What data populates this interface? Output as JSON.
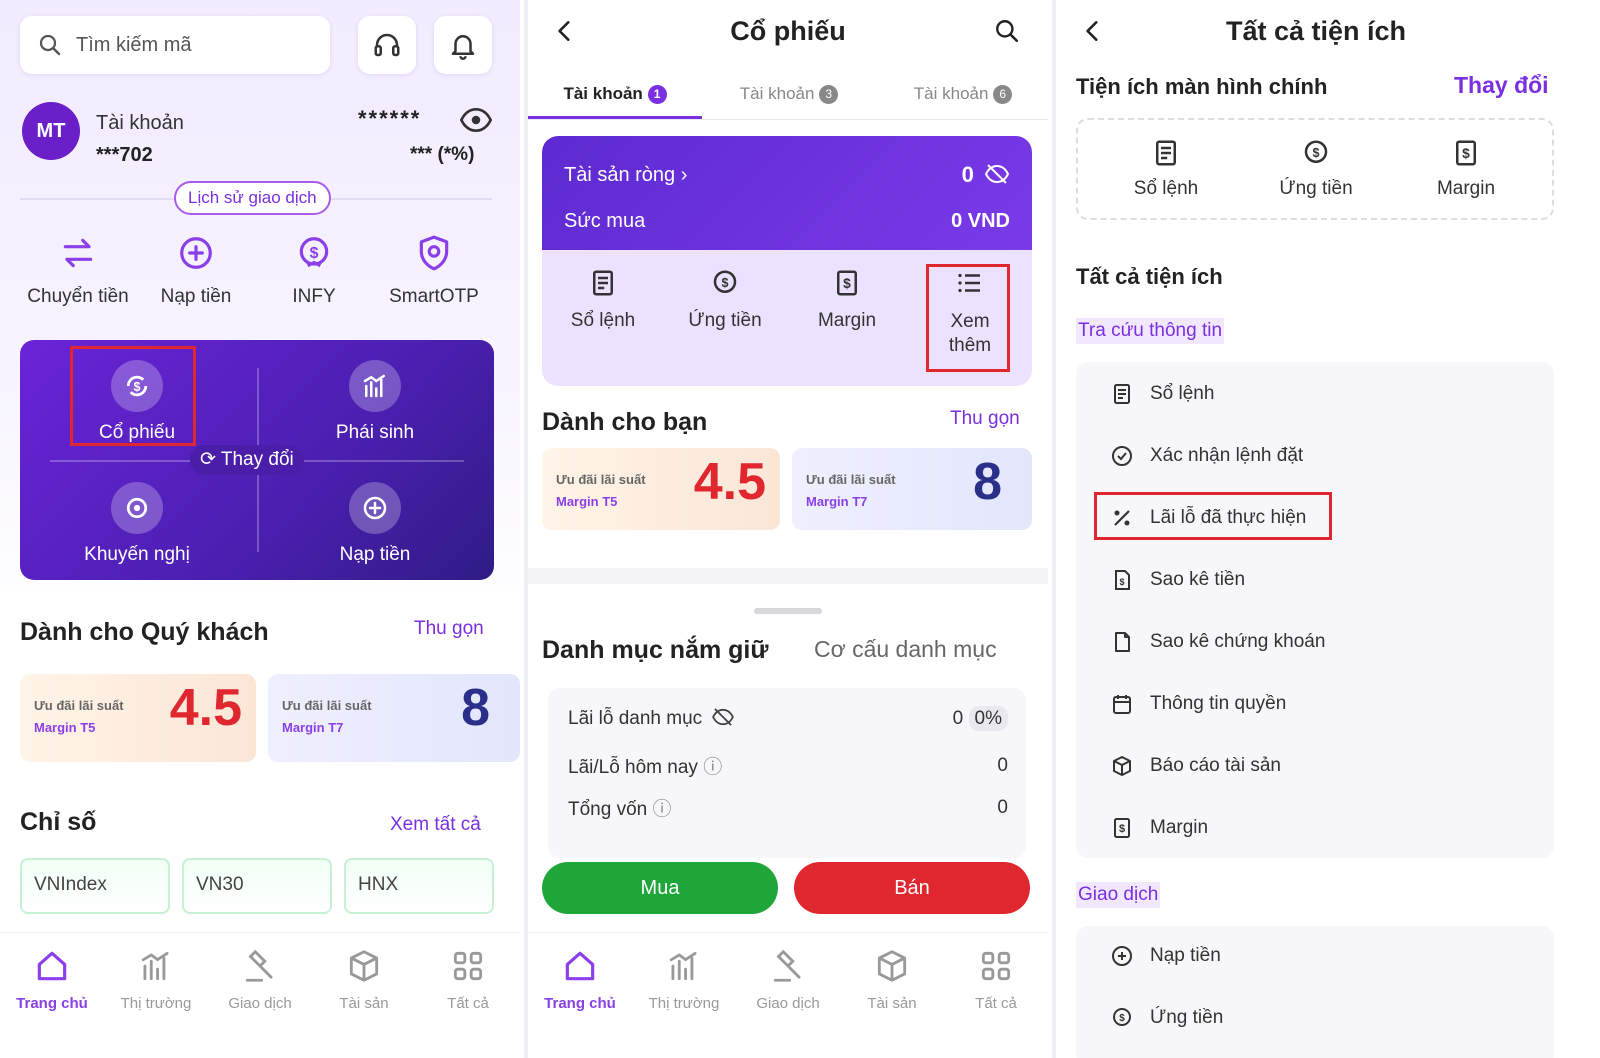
{
  "home": {
    "search_placeholder": "Tìm kiếm mã",
    "avatar_initials": "MT",
    "account_label": "Tài khoản",
    "account_number": "***702",
    "balance_masked": "******",
    "pnl_masked": "*** (*%)",
    "history_button": "Lịch sử giao dịch",
    "quick_actions": [
      "Chuyển tiền",
      "Nạp tiền",
      "INFY",
      "SmartOTP"
    ],
    "products": [
      "Cổ phiếu",
      "Phái sinh",
      "Khuyến nghị",
      "Nạp tiền"
    ],
    "change_label": "Thay đổi",
    "for_you_title": "Dành cho Quý khách",
    "collapse_link": "Thu gọn",
    "promos": [
      {
        "line1": "Ưu đãi lãi suất",
        "line2": "Margin T5",
        "big": "4.5",
        "big_color": "#e0262f"
      },
      {
        "line1": "Ưu đãi lãi suất",
        "line2": "Margin T7",
        "big": "8",
        "big_color": "#2a2f8a"
      }
    ],
    "index_title": "Chỉ số",
    "see_all_link": "Xem tất cả",
    "indices": [
      "VNIndex",
      "VN30",
      "HNX"
    ]
  },
  "tabbar": [
    "Trang chủ",
    "Thị trường",
    "Giao dịch",
    "Tài sản",
    "Tất cả"
  ],
  "stocks": {
    "title": "Cổ phiếu",
    "account_tabs": [
      {
        "label": "Tài khoản",
        "badge": "1"
      },
      {
        "label": "Tài khoản",
        "badge": "3"
      },
      {
        "label": "Tài khoản",
        "badge": "6"
      }
    ],
    "net_assets_label": "Tài sản ròng",
    "net_assets_value": "0",
    "buying_power_label": "Sức mua",
    "buying_power_value": "0 VND",
    "features": [
      "Sổ lệnh",
      "Ứng tiền",
      "Margin",
      "Xem thêm"
    ],
    "for_you_title": "Dành cho bạn",
    "collapse_link": "Thu gọn",
    "holdings_tab_active": "Danh mục nắm giữ",
    "holdings_tab_other": "Cơ cấu danh mục",
    "holdings_rows": [
      {
        "label": "Lãi lỗ danh mục",
        "value": "0",
        "extra": "0%"
      },
      {
        "label": "Lãi/Lỗ hôm nay",
        "value": "0"
      },
      {
        "label": "Tổng vốn",
        "value": "0"
      }
    ],
    "buy_button": "Mua",
    "sell_button": "Bán"
  },
  "utilities": {
    "title": "Tất cả tiện ích",
    "main_screen_title": "Tiện ích màn hình chính",
    "change_link": "Thay đổi",
    "shortcuts": [
      "Sổ lệnh",
      "Ứng tiền",
      "Margin"
    ],
    "all_title": "Tất cả tiện ích",
    "lookup_group": "Tra cứu thông tin",
    "lookup_items": [
      "Sổ lệnh",
      "Xác nhận lệnh đặt",
      "Lãi lỗ đã thực hiện",
      "Sao kê tiền",
      "Sao kê chứng khoán",
      "Thông tin quyền",
      "Báo cáo tài sản",
      "Margin"
    ],
    "trade_group": "Giao dịch",
    "trade_items": [
      "Nạp tiền",
      "Ứng tiền"
    ]
  },
  "colors": {
    "accent": "#7a2fe0",
    "buy": "#1fa63a",
    "sell": "#e0262f",
    "highlight": "#e0262f"
  }
}
